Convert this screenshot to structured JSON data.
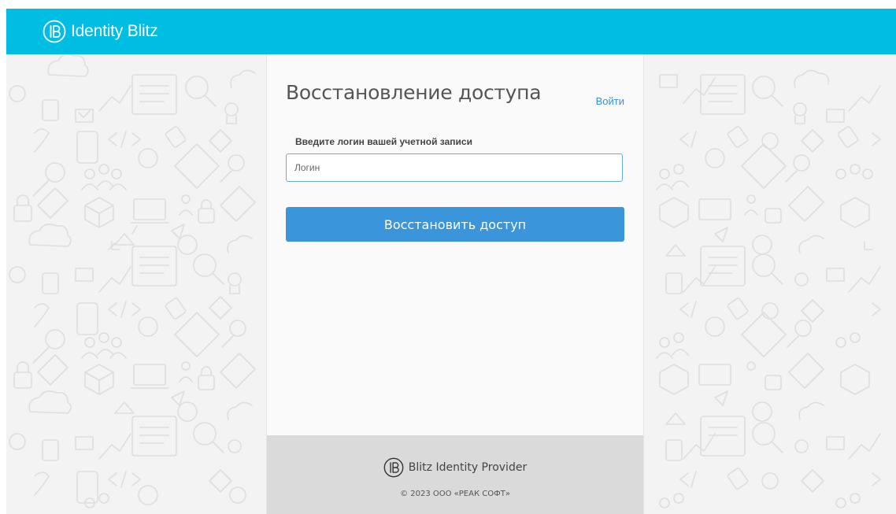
{
  "header": {
    "logo_icon": "identity-blitz-logo-icon",
    "brand_name": "Identity Blitz",
    "bar_color": "#00bde4"
  },
  "recovery_form": {
    "title": "Восстановление доступа",
    "login_link": "Войти",
    "field_label": "Введите логин вашей учетной записи",
    "login_input": {
      "placeholder": "Логин",
      "value": ""
    },
    "submit_button": "Восстановить доступ",
    "button_color": "#3b95db",
    "link_color": "#3a8fd6"
  },
  "footer": {
    "logo_icon": "blitz-identity-provider-logo-icon",
    "product_name": "Blitz Identity Provider",
    "copyright": "© 2023 ООО «РЕАК СОФТ»"
  }
}
